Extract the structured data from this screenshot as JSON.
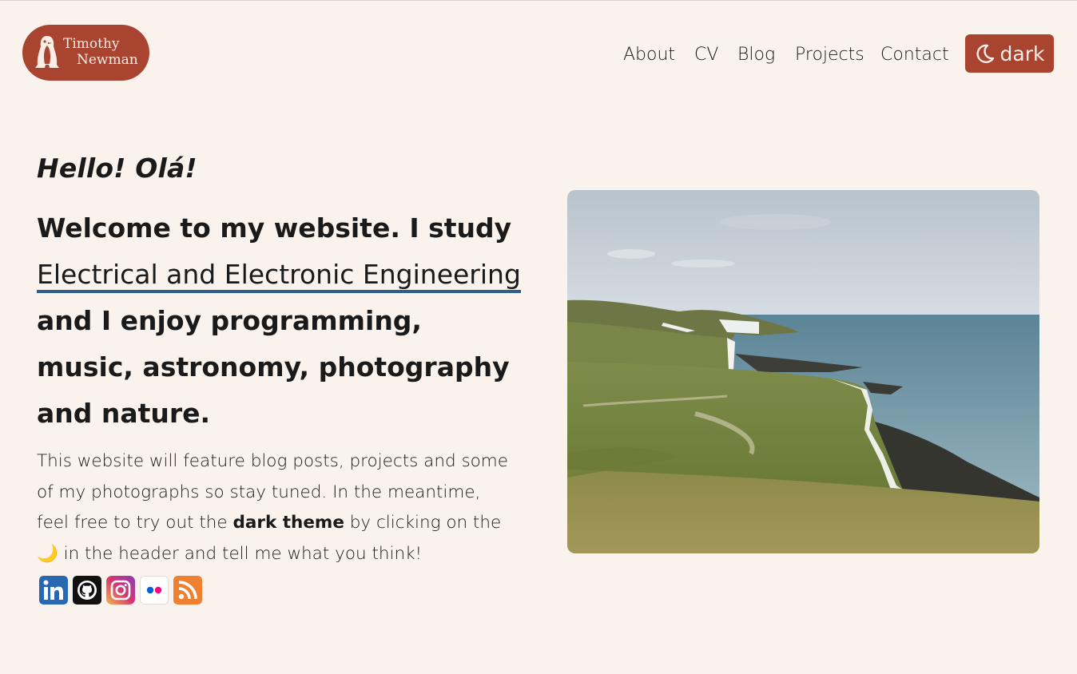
{
  "header": {
    "logo_line1": "Timothy",
    "logo_line2": "Newman",
    "nav": [
      "About",
      "CV",
      "Blog",
      "Projects",
      "Contact"
    ],
    "theme_button_label": "dark"
  },
  "main": {
    "greeting": "Hello! Olá!",
    "welcome_before": "Welcome to my website. I study ",
    "welcome_link": "Electrical and Electronic Engineering",
    "welcome_after": " and I enjoy programming, music, astronomy, photography and nature.",
    "intro_before": "This website will feature blog posts, projects and some of my photographs so stay tuned. In the meantime, feel free to try out the ",
    "intro_bold": "dark theme",
    "intro_after": " by clicking on the 🌙 in the header and tell me what you think!"
  },
  "socials": [
    "linkedin-icon",
    "github-icon",
    "instagram-icon",
    "flickr-icon",
    "rss-icon"
  ],
  "colors": {
    "background": "#f9f2ed",
    "accent": "#a84430",
    "link_underline": "#2e5f8a"
  }
}
